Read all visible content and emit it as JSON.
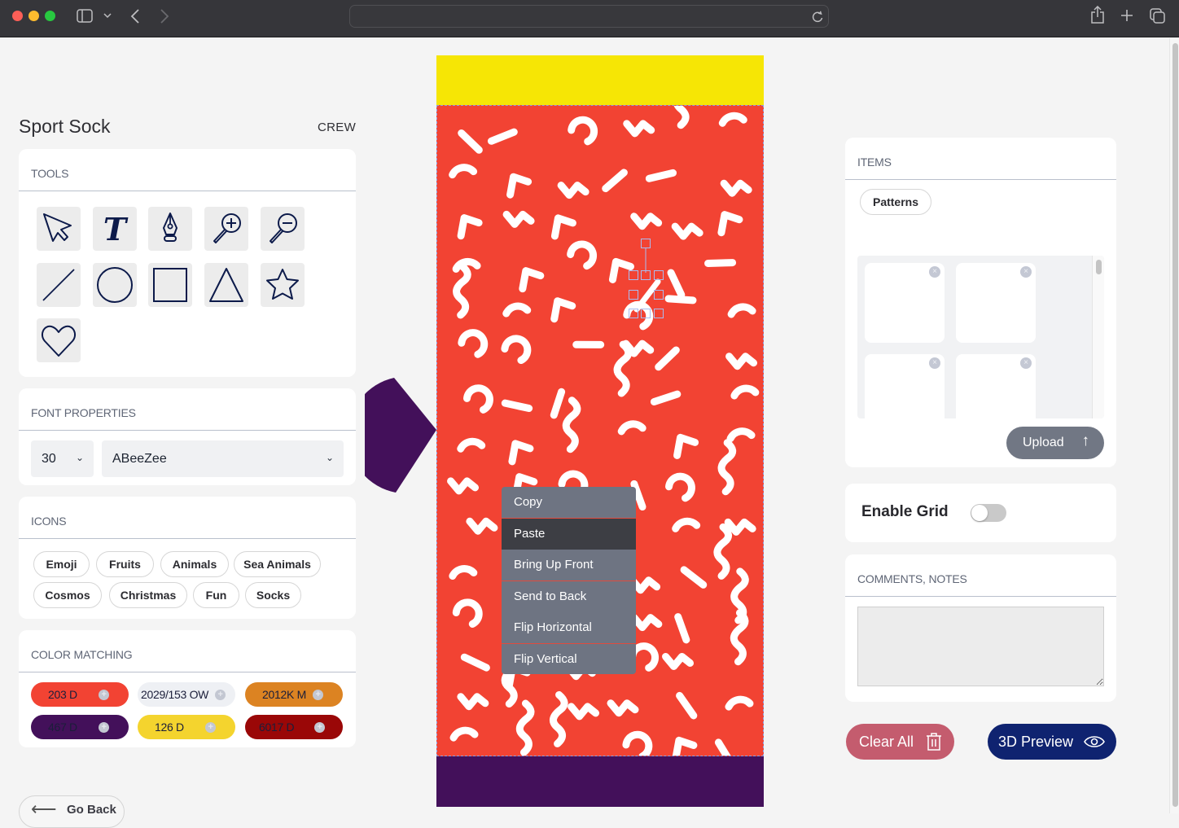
{
  "browser": {
    "url": "",
    "buttons": [
      "sidebar-toggle",
      "back",
      "forward",
      "reload",
      "share",
      "new-tab",
      "tab-overview"
    ]
  },
  "header": {
    "title": "Sport Sock",
    "style": "CREW"
  },
  "tools": {
    "heading": "TOOLS",
    "items": [
      {
        "name": "select",
        "icon": "cursor-arrow-icon"
      },
      {
        "name": "text",
        "icon": "text-t-icon",
        "glyph": "T"
      },
      {
        "name": "pen",
        "icon": "pen-nib-icon"
      },
      {
        "name": "zoom-in",
        "icon": "zoom-in-icon"
      },
      {
        "name": "zoom-out",
        "icon": "zoom-out-icon"
      },
      {
        "name": "line",
        "icon": "line-icon"
      },
      {
        "name": "circle",
        "icon": "circle-icon"
      },
      {
        "name": "square",
        "icon": "square-icon"
      },
      {
        "name": "triangle",
        "icon": "triangle-icon"
      },
      {
        "name": "star",
        "icon": "star-icon"
      },
      {
        "name": "heart",
        "icon": "heart-icon"
      }
    ]
  },
  "font_properties": {
    "heading": "FONT PROPERTIES",
    "size": "30",
    "family": "ABeeZee"
  },
  "icons": {
    "heading": "ICONS",
    "categories": [
      "Emoji",
      "Fruits",
      "Animals",
      "Sea Animals",
      "Cosmos",
      "Christmas",
      "Fun",
      "Socks"
    ]
  },
  "color_matching": {
    "heading": "COLOR MATCHING",
    "swatches": [
      {
        "label": "203 D",
        "color": "#f24333"
      },
      {
        "label": "2029/153 OW",
        "color": "#eef0f4"
      },
      {
        "label": "2012K M",
        "color": "#dc8322"
      },
      {
        "label": "467 D",
        "color": "#43105a"
      },
      {
        "label": "126 D",
        "color": "#f4d42e"
      },
      {
        "label": "6017 D",
        "color": "#9a0707"
      }
    ]
  },
  "go_back": "Go Back",
  "canvas": {
    "colors": {
      "top_band": "#f6e605",
      "main": "#f24333",
      "bottom_band": "#43105a",
      "pattern": "#ffffff"
    }
  },
  "context_menu": {
    "items": [
      "Copy",
      "Paste",
      "Bring Up Front",
      "Send to Back",
      "Flip Horizontal",
      "Flip Vertical"
    ],
    "highlighted": "Paste"
  },
  "items_panel": {
    "heading": "ITEMS",
    "filter": "Patterns",
    "upload_label": "Upload"
  },
  "grid": {
    "label": "Enable Grid",
    "enabled": false
  },
  "comments": {
    "heading": "COMMENTS, NOTES",
    "value": ""
  },
  "actions": {
    "clear_all": "Clear All",
    "preview": "3D Preview"
  }
}
